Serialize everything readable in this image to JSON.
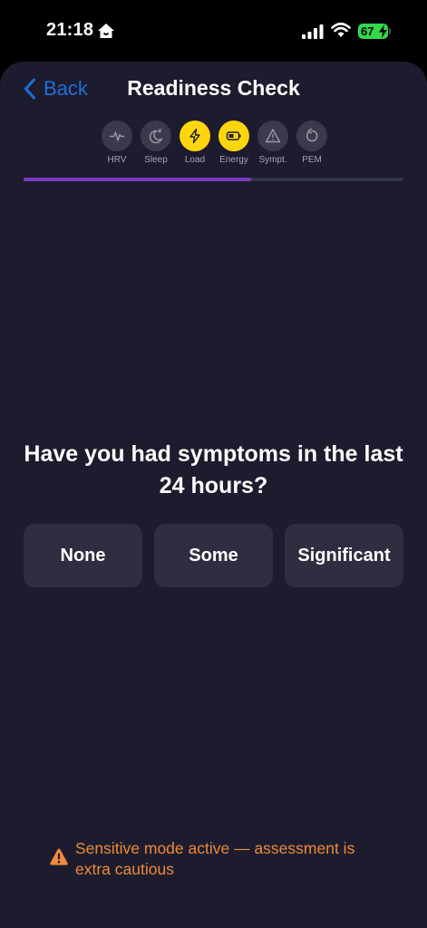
{
  "status_bar": {
    "time": "21:18",
    "battery": "67"
  },
  "nav": {
    "back_label": "Back",
    "title": "Readiness Check"
  },
  "steps": [
    {
      "label": "HRV",
      "icon": "heartbeat-icon",
      "state": "done"
    },
    {
      "label": "Sleep",
      "icon": "moon-icon",
      "state": "done"
    },
    {
      "label": "Load",
      "icon": "bolt-icon",
      "state": "active"
    },
    {
      "label": "Energy",
      "icon": "battery-icon",
      "state": "active"
    },
    {
      "label": "Sympt.",
      "icon": "warning-icon",
      "state": "pending"
    },
    {
      "label": "PEM",
      "icon": "refresh-icon",
      "state": "pending"
    }
  ],
  "progress": 0.6,
  "colors": {
    "accent": "#ffd60a",
    "progress": "#7e3cc4",
    "link": "#1e6fd9",
    "warning": "#f08a36",
    "background": "#1c1c2e"
  },
  "question": "Have you had symptoms in the last 24 hours?",
  "options": [
    "None",
    "Some",
    "Significant"
  ],
  "notice": "Sensitive mode active — assessment is extra cautious"
}
